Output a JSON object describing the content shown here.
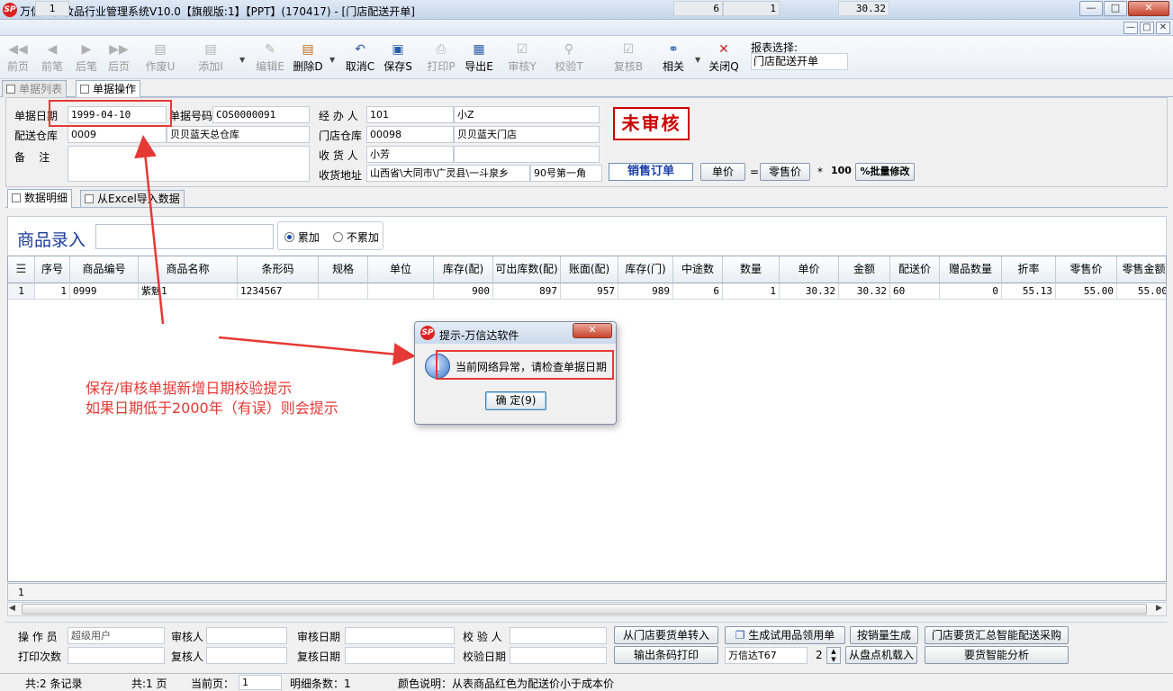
{
  "window": {
    "title": "万信达化妆品行业管理系统V10.0【旗舰版:1】【PPT】(170417) - [门店配送开单]",
    "logo": "SP",
    "min": "—",
    "max": "□",
    "close": "✕"
  },
  "toolbar": {
    "items": [
      {
        "label": "前页",
        "icon": "◀◀"
      },
      {
        "label": "前笔",
        "icon": "◀"
      },
      {
        "label": "后笔",
        "icon": "▶"
      },
      {
        "label": "后页",
        "icon": "▶▶"
      },
      {
        "label": "作废U",
        "icon": "▤"
      },
      {
        "label": "添加I",
        "icon": "▤"
      },
      {
        "label": "编辑E",
        "icon": "✎"
      },
      {
        "label": "删除D",
        "icon": "▤"
      },
      {
        "label": "取消C",
        "icon": "↶"
      },
      {
        "label": "保存S",
        "icon": "▣"
      },
      {
        "label": "打印P",
        "icon": "⎙"
      },
      {
        "label": "导出E",
        "icon": "▦"
      },
      {
        "label": "审核Y",
        "icon": "☑"
      },
      {
        "label": "校验T",
        "icon": "⚲"
      },
      {
        "label": "复核B",
        "icon": "☑"
      },
      {
        "label": "相关",
        "icon": "⚭"
      },
      {
        "label": "关闭Q",
        "icon": "✕"
      }
    ],
    "report_label": "报表选择:",
    "report_value": "门店配送开单"
  },
  "tabs": {
    "list": "单据列表",
    "op": "单据操作"
  },
  "form": {
    "date_label": "单据日期",
    "date": "1999-04-10",
    "no_label": "单据号码",
    "no": "COS0000091",
    "handler_label": "经 办 人",
    "handler_id": "101",
    "handler_name": "小Z",
    "wh_label": "配送仓库",
    "wh_id": "0009",
    "wh_name": "贝贝蓝天总仓库",
    "store_label": "门店仓库",
    "store_id": "00098",
    "store_name": "贝贝蓝天门店",
    "note_label": "备    注",
    "receiver_label": "收 货 人",
    "receiver": "小芳",
    "addr_label": "收货地址",
    "addr1": "山西省\\大同市\\广灵县\\一斗泉乡",
    "addr2": "90号第一角",
    "stamp": "未审核",
    "order_type": "销售订单",
    "price_btn": "单价",
    "eq": "=",
    "retail_btn": "零售价",
    "times": "*",
    "pct": "100",
    "batch_btn": "%批量修改"
  },
  "subtabs": {
    "detail": "数据明细",
    "excel": "从Excel导入数据"
  },
  "entry": {
    "label": "商品录入",
    "accum": "累加",
    "no_accum": "不累加"
  },
  "grid": {
    "headers": [
      "序号",
      "商品编号",
      "商品名称",
      "条形码",
      "规格",
      "单位",
      "库存(配)",
      "可出库数(配)",
      "账面(配)",
      "库存(门)",
      "中途数",
      "数量",
      "单价",
      "金额",
      "配送价",
      "赠品数量",
      "折率",
      "零售价",
      "零售金额"
    ],
    "rows": [
      {
        "idx": "1",
        "cells": [
          "1",
          "0999",
          "紫魅1",
          "1234567",
          "",
          "",
          "900",
          "897",
          "957",
          "989",
          "6",
          "1",
          "30.32",
          "30.32",
          "60",
          "0",
          "55.13",
          "55.00",
          "55.00"
        ]
      }
    ],
    "summary": {
      "idx": "1",
      "count": "1",
      "transit": "6",
      "qty": "1",
      "amount": "30.32"
    }
  },
  "dialog": {
    "title": "提示-万信达软件",
    "message": "当前网络异常，请检查单据日期",
    "ok": "确 定(9)",
    "close": "✕",
    "icon": "i"
  },
  "annotation": {
    "line1": "保存/审核单据新增日期校验提示",
    "line2": "如果日期低于2000年（有误）则会提示"
  },
  "bottom": {
    "operator_label": "操 作 员",
    "operator": "超级用户",
    "reviewer_label": "审核人",
    "review_date_label": "审核日期",
    "checker_label": "校 验 人",
    "print_count_label": "打印次数",
    "rechecker_label": "复核人",
    "recheck_date_label": "复核日期",
    "check_date_label": "校验日期",
    "btn_from_store": "从门店要货单转入",
    "btn_trial": "生成试用品领用单",
    "btn_by_sales": "按销量生成",
    "btn_smart": "门店要货汇总智能配送采购",
    "btn_barcode": "输出条码打印",
    "printer": "万信达T67",
    "copies": "2",
    "btn_inventory": "从盘点机载入",
    "btn_analysis": "要货智能分析"
  },
  "status": {
    "records": "共:2 条记录",
    "pages": "共:1 页",
    "current_label": "当前页：",
    "current": "1",
    "detail_count": "明细条数：1",
    "color_note": "颜色说明：从表商品红色为配送价小于成本价"
  }
}
